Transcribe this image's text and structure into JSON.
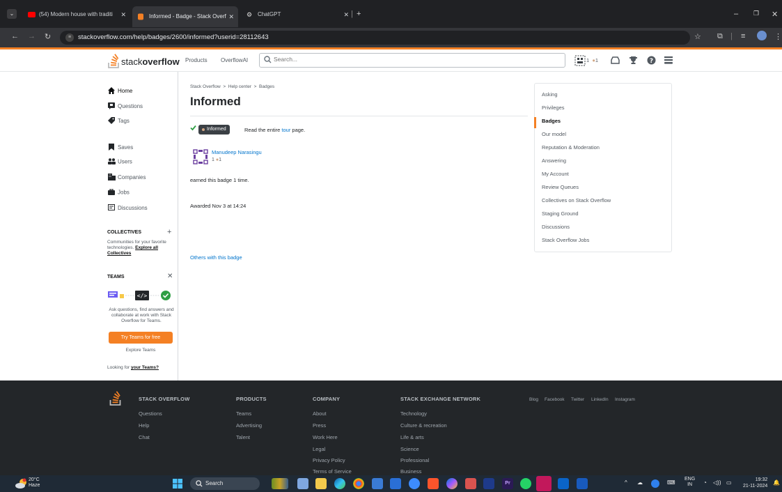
{
  "browser": {
    "tabs": [
      {
        "title": "(54) Modern house with traditi",
        "active": false,
        "favicon_color": "#ff0000"
      },
      {
        "title": "Informed - Badge - Stack Overf",
        "active": true,
        "favicon_color": "#f48024"
      },
      {
        "title": "ChatGPT",
        "active": false,
        "favicon_color": "#d0d0d0"
      }
    ],
    "url": "stackoverflow.com/help/badges/2600/informed?userid=28112643"
  },
  "header": {
    "logo_plain": "stack",
    "logo_bold": "overflow",
    "nav": [
      "Products",
      "OverflowAI"
    ],
    "search_placeholder": "Search...",
    "rep": "1",
    "bronze": "1"
  },
  "sidebar": {
    "items": [
      {
        "label": "Home",
        "icon": "home-icon"
      },
      {
        "label": "Questions",
        "icon": "questions-icon"
      },
      {
        "label": "Tags",
        "icon": "tag-icon"
      },
      {
        "label": "Saves",
        "icon": "bookmark-icon"
      },
      {
        "label": "Users",
        "icon": "users-icon"
      },
      {
        "label": "Companies",
        "icon": "companies-icon"
      },
      {
        "label": "Jobs",
        "icon": "briefcase-icon"
      },
      {
        "label": "Discussions",
        "icon": "discussions-icon"
      }
    ],
    "collectives": {
      "title": "COLLECTIVES",
      "text": "Communities for your favorite technologies.",
      "link": "Explore all Collectives"
    },
    "teams": {
      "title": "TEAMS",
      "text": "Ask questions, find answers and collaborate at work with Stack Overflow for Teams.",
      "button": "Try Teams for free",
      "explore": "Explore Teams",
      "looking_prefix": "Looking for",
      "looking_link": "your Teams?"
    }
  },
  "main": {
    "breadcrumb": [
      "Stack Overflow",
      "Help center",
      "Badges"
    ],
    "title": "Informed",
    "badge_name": "Informed",
    "badge_desc_prefix": "Read the entire",
    "badge_desc_link": "tour",
    "badge_desc_suffix": "page.",
    "user_name": "Manudeep Narasingu",
    "user_rep": "1",
    "user_bronze": "1",
    "earned_prefix": "earned this badge",
    "earned_count": "1",
    "earned_suffix": "time.",
    "awarded": "Awarded Nov 3 at 14:24",
    "others_link": "Others with this badge"
  },
  "help_menu": [
    {
      "label": "Asking",
      "active": false
    },
    {
      "label": "Privileges",
      "active": false
    },
    {
      "label": "Badges",
      "active": true
    },
    {
      "label": "Our model",
      "active": false
    },
    {
      "label": "Reputation & Moderation",
      "active": false
    },
    {
      "label": "Answering",
      "active": false
    },
    {
      "label": "My Account",
      "active": false
    },
    {
      "label": "Review Queues",
      "active": false
    },
    {
      "label": "Collectives on Stack Overflow",
      "active": false
    },
    {
      "label": "Staging Ground",
      "active": false
    },
    {
      "label": "Discussions",
      "active": false
    },
    {
      "label": "Stack Overflow Jobs",
      "active": false
    }
  ],
  "footer": {
    "columns": [
      {
        "title": "STACK OVERFLOW",
        "links": [
          "Questions",
          "Help",
          "Chat"
        ]
      },
      {
        "title": "PRODUCTS",
        "links": [
          "Teams",
          "Advertising",
          "Talent"
        ]
      },
      {
        "title": "COMPANY",
        "links": [
          "About",
          "Press",
          "Work Here",
          "Legal",
          "Privacy Policy",
          "Terms of Service"
        ]
      },
      {
        "title": "STACK EXCHANGE NETWORK",
        "links": [
          "Technology",
          "Culture & recreation",
          "Life & arts",
          "Science",
          "Professional",
          "Business"
        ]
      }
    ],
    "social": [
      "Blog",
      "Facebook",
      "Twitter",
      "LinkedIn",
      "Instagram"
    ]
  },
  "taskbar": {
    "temp": "20°C",
    "weather": "Haze",
    "search": "Search",
    "lang": "ENG",
    "region": "IN",
    "time": "19:32",
    "date": "21-11-2024"
  }
}
